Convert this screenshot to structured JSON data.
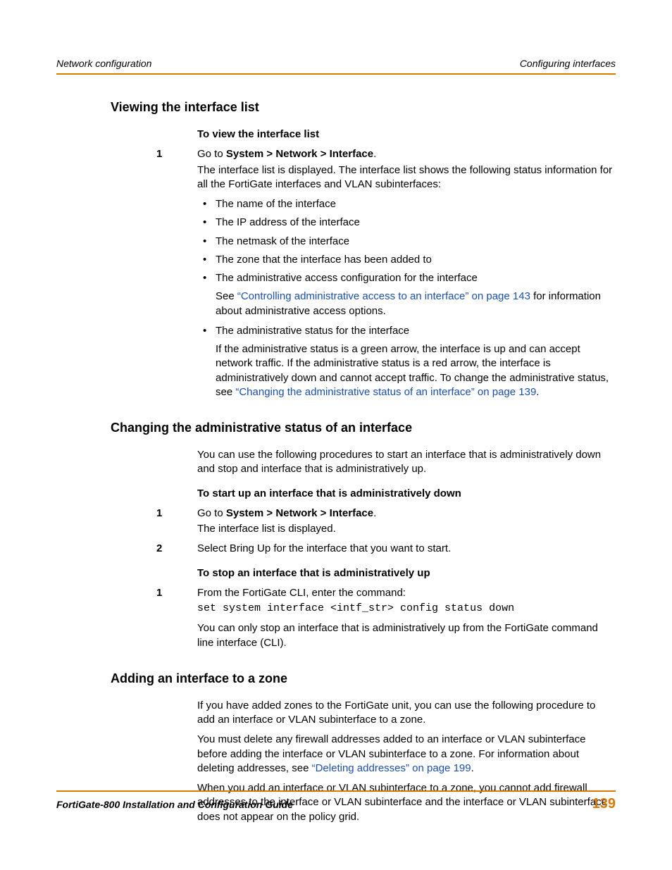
{
  "header": {
    "left": "Network configuration",
    "right": "Configuring interfaces"
  },
  "section1": {
    "heading": "Viewing the interface list",
    "sub1": "To view the interface list",
    "step1_pre": "Go to ",
    "step1_bold": "System > Network > Interface",
    "step1_post": ".",
    "step1_para": "The interface list is displayed. The interface list shows the following status information for all the FortiGate interfaces and VLAN subinterfaces:",
    "b1": "The name of the interface",
    "b2": "The IP address of the interface",
    "b3": "The netmask of the interface",
    "b4": "The zone that the interface has been added to",
    "b5": "The administrative access configuration for the interface",
    "b5_sub_pre": "See ",
    "b5_link": "“Controlling administrative access to an interface” on page 143",
    "b5_sub_post": " for information about administrative access options.",
    "b6": "The administrative status for the interface",
    "b6_sub_pre": "If the administrative status is a green arrow, the interface is up and can accept network traffic. If the administrative status is a red arrow, the interface is administratively down and cannot accept traffic. To change the administrative status, see ",
    "b6_link": "“Changing the administrative status of an interface” on page 139",
    "b6_sub_post": "."
  },
  "section2": {
    "heading": "Changing the administrative status of an interface",
    "intro": "You can use the following procedures to start an interface that is administratively down and stop and interface that is administratively up.",
    "sub1": "To start up an interface that is administratively down",
    "s1_step1_pre": "Go to ",
    "s1_step1_bold": "System > Network > Interface",
    "s1_step1_post": ".",
    "s1_step1_para": "The interface list is displayed.",
    "s1_step2": "Select Bring Up for the interface that you want to start.",
    "sub2": "To stop an interface that is administratively up",
    "s2_step1": "From the FortiGate CLI, enter the command:",
    "s2_code": "set system interface <intf_str> config status down",
    "s2_para": "You can only stop an interface that is administratively up from the FortiGate command line interface (CLI)."
  },
  "section3": {
    "heading": "Adding an interface to a zone",
    "p1": "If you have added zones to the FortiGate unit, you can use the following procedure to add an interface or VLAN subinterface to a zone.",
    "p2_pre": "You must delete any firewall addresses added to an interface or VLAN subinterface before adding the interface or VLAN subinterface to a zone. For information about deleting addresses, see ",
    "p2_link": "“Deleting addresses” on page 199",
    "p2_post": ".",
    "p3": "When you add an interface or VLAN subinterface to a zone, you cannot add firewall addresses to the interface or VLAN subinterface and the interface or VLAN subinterface does not appear on the policy grid."
  },
  "footer": {
    "title": "FortiGate-800 Installation and Configuration Guide",
    "page": "139"
  },
  "nums": {
    "n1": "1",
    "n2": "2"
  }
}
